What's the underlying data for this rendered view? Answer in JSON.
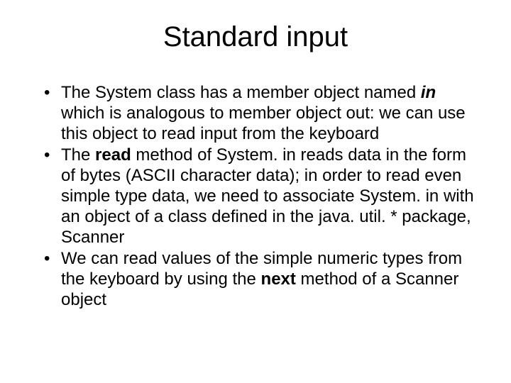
{
  "title": "Standard input",
  "bullets": [
    {
      "pre1": "The System class has a member object named ",
      "bi1": "in",
      "post1": " which is analogous to member object out: we can use this object to read input from the keyboard"
    },
    {
      "pre1": "The ",
      "b1": "read",
      "post1": " method of System. in reads data in the form of bytes (ASCII character data); in order to read even simple type data, we need to associate System. in with an object of a class defined in the java. util. * package, Scanner"
    },
    {
      "pre1": "We can read values of the simple numeric types from the keyboard by using the ",
      "b1": "next",
      "post1": " method of a Scanner object"
    }
  ]
}
